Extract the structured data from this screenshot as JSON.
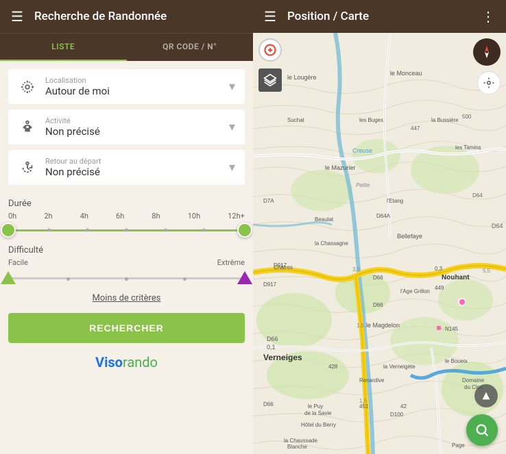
{
  "left": {
    "header": {
      "title": "Recherche de Randonnée",
      "menu_icon": "☰"
    },
    "tabs": [
      {
        "id": "liste",
        "label": "LISTE",
        "active": true
      },
      {
        "id": "qr",
        "label": "QR CODE / N°",
        "active": false
      }
    ],
    "filters": [
      {
        "id": "localisation",
        "label": "Localisation",
        "value": "Autour de moi",
        "icon": "⊙"
      },
      {
        "id": "activite",
        "label": "Activité",
        "value": "Non précisé",
        "icon": "🚶"
      },
      {
        "id": "retour",
        "label": "Retour au départ",
        "value": "Non précisé",
        "icon": "↺"
      }
    ],
    "duration": {
      "title": "Durée",
      "labels": [
        "0h",
        "2h",
        "4h",
        "6h",
        "8h",
        "10h",
        "12h+"
      ]
    },
    "difficulty": {
      "title": "Difficulté",
      "label_left": "Facile",
      "label_right": "Extrême"
    },
    "moins_criteres": "Moins de critères",
    "rechercher_btn": "RECHERCHER",
    "logo": {
      "viso": "Viso",
      "rando": "rando"
    }
  },
  "right": {
    "header": {
      "title": "Position / Carte",
      "menu_icon": "☰",
      "more_icon": "⋮"
    },
    "map_buttons": {
      "plus": "+",
      "search": "🔍",
      "up": "▲"
    }
  }
}
